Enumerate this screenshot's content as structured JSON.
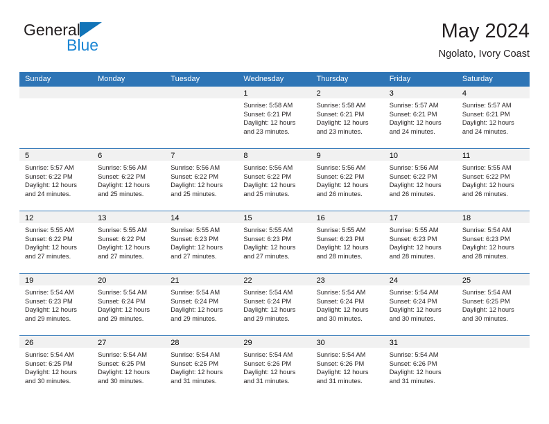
{
  "brand": {
    "name_top": "General",
    "name_bottom": "Blue",
    "triangle_color": "#1274b8",
    "blue_color": "#1b86d4"
  },
  "header": {
    "title": "May 2024",
    "subtitle": "Ngolato, Ivory Coast"
  },
  "theme": {
    "header_blue": "#2e75b6",
    "daynum_band": "#f1f1f1",
    "text": "#231f20"
  },
  "calendar": {
    "weekday_headers": [
      "Sunday",
      "Monday",
      "Tuesday",
      "Wednesday",
      "Thursday",
      "Friday",
      "Saturday"
    ],
    "weeks": [
      [
        {
          "day": "",
          "lines": []
        },
        {
          "day": "",
          "lines": []
        },
        {
          "day": "",
          "lines": []
        },
        {
          "day": "1",
          "lines": [
            "Sunrise: 5:58 AM",
            "Sunset: 6:21 PM",
            "Daylight: 12 hours",
            "and 23 minutes."
          ]
        },
        {
          "day": "2",
          "lines": [
            "Sunrise: 5:58 AM",
            "Sunset: 6:21 PM",
            "Daylight: 12 hours",
            "and 23 minutes."
          ]
        },
        {
          "day": "3",
          "lines": [
            "Sunrise: 5:57 AM",
            "Sunset: 6:21 PM",
            "Daylight: 12 hours",
            "and 24 minutes."
          ]
        },
        {
          "day": "4",
          "lines": [
            "Sunrise: 5:57 AM",
            "Sunset: 6:21 PM",
            "Daylight: 12 hours",
            "and 24 minutes."
          ]
        }
      ],
      [
        {
          "day": "5",
          "lines": [
            "Sunrise: 5:57 AM",
            "Sunset: 6:22 PM",
            "Daylight: 12 hours",
            "and 24 minutes."
          ]
        },
        {
          "day": "6",
          "lines": [
            "Sunrise: 5:56 AM",
            "Sunset: 6:22 PM",
            "Daylight: 12 hours",
            "and 25 minutes."
          ]
        },
        {
          "day": "7",
          "lines": [
            "Sunrise: 5:56 AM",
            "Sunset: 6:22 PM",
            "Daylight: 12 hours",
            "and 25 minutes."
          ]
        },
        {
          "day": "8",
          "lines": [
            "Sunrise: 5:56 AM",
            "Sunset: 6:22 PM",
            "Daylight: 12 hours",
            "and 25 minutes."
          ]
        },
        {
          "day": "9",
          "lines": [
            "Sunrise: 5:56 AM",
            "Sunset: 6:22 PM",
            "Daylight: 12 hours",
            "and 26 minutes."
          ]
        },
        {
          "day": "10",
          "lines": [
            "Sunrise: 5:56 AM",
            "Sunset: 6:22 PM",
            "Daylight: 12 hours",
            "and 26 minutes."
          ]
        },
        {
          "day": "11",
          "lines": [
            "Sunrise: 5:55 AM",
            "Sunset: 6:22 PM",
            "Daylight: 12 hours",
            "and 26 minutes."
          ]
        }
      ],
      [
        {
          "day": "12",
          "lines": [
            "Sunrise: 5:55 AM",
            "Sunset: 6:22 PM",
            "Daylight: 12 hours",
            "and 27 minutes."
          ]
        },
        {
          "day": "13",
          "lines": [
            "Sunrise: 5:55 AM",
            "Sunset: 6:22 PM",
            "Daylight: 12 hours",
            "and 27 minutes."
          ]
        },
        {
          "day": "14",
          "lines": [
            "Sunrise: 5:55 AM",
            "Sunset: 6:23 PM",
            "Daylight: 12 hours",
            "and 27 minutes."
          ]
        },
        {
          "day": "15",
          "lines": [
            "Sunrise: 5:55 AM",
            "Sunset: 6:23 PM",
            "Daylight: 12 hours",
            "and 27 minutes."
          ]
        },
        {
          "day": "16",
          "lines": [
            "Sunrise: 5:55 AM",
            "Sunset: 6:23 PM",
            "Daylight: 12 hours",
            "and 28 minutes."
          ]
        },
        {
          "day": "17",
          "lines": [
            "Sunrise: 5:55 AM",
            "Sunset: 6:23 PM",
            "Daylight: 12 hours",
            "and 28 minutes."
          ]
        },
        {
          "day": "18",
          "lines": [
            "Sunrise: 5:54 AM",
            "Sunset: 6:23 PM",
            "Daylight: 12 hours",
            "and 28 minutes."
          ]
        }
      ],
      [
        {
          "day": "19",
          "lines": [
            "Sunrise: 5:54 AM",
            "Sunset: 6:23 PM",
            "Daylight: 12 hours",
            "and 29 minutes."
          ]
        },
        {
          "day": "20",
          "lines": [
            "Sunrise: 5:54 AM",
            "Sunset: 6:24 PM",
            "Daylight: 12 hours",
            "and 29 minutes."
          ]
        },
        {
          "day": "21",
          "lines": [
            "Sunrise: 5:54 AM",
            "Sunset: 6:24 PM",
            "Daylight: 12 hours",
            "and 29 minutes."
          ]
        },
        {
          "day": "22",
          "lines": [
            "Sunrise: 5:54 AM",
            "Sunset: 6:24 PM",
            "Daylight: 12 hours",
            "and 29 minutes."
          ]
        },
        {
          "day": "23",
          "lines": [
            "Sunrise: 5:54 AM",
            "Sunset: 6:24 PM",
            "Daylight: 12 hours",
            "and 30 minutes."
          ]
        },
        {
          "day": "24",
          "lines": [
            "Sunrise: 5:54 AM",
            "Sunset: 6:24 PM",
            "Daylight: 12 hours",
            "and 30 minutes."
          ]
        },
        {
          "day": "25",
          "lines": [
            "Sunrise: 5:54 AM",
            "Sunset: 6:25 PM",
            "Daylight: 12 hours",
            "and 30 minutes."
          ]
        }
      ],
      [
        {
          "day": "26",
          "lines": [
            "Sunrise: 5:54 AM",
            "Sunset: 6:25 PM",
            "Daylight: 12 hours",
            "and 30 minutes."
          ]
        },
        {
          "day": "27",
          "lines": [
            "Sunrise: 5:54 AM",
            "Sunset: 6:25 PM",
            "Daylight: 12 hours",
            "and 30 minutes."
          ]
        },
        {
          "day": "28",
          "lines": [
            "Sunrise: 5:54 AM",
            "Sunset: 6:25 PM",
            "Daylight: 12 hours",
            "and 31 minutes."
          ]
        },
        {
          "day": "29",
          "lines": [
            "Sunrise: 5:54 AM",
            "Sunset: 6:26 PM",
            "Daylight: 12 hours",
            "and 31 minutes."
          ]
        },
        {
          "day": "30",
          "lines": [
            "Sunrise: 5:54 AM",
            "Sunset: 6:26 PM",
            "Daylight: 12 hours",
            "and 31 minutes."
          ]
        },
        {
          "day": "31",
          "lines": [
            "Sunrise: 5:54 AM",
            "Sunset: 6:26 PM",
            "Daylight: 12 hours",
            "and 31 minutes."
          ]
        },
        {
          "day": "",
          "lines": []
        }
      ]
    ]
  }
}
